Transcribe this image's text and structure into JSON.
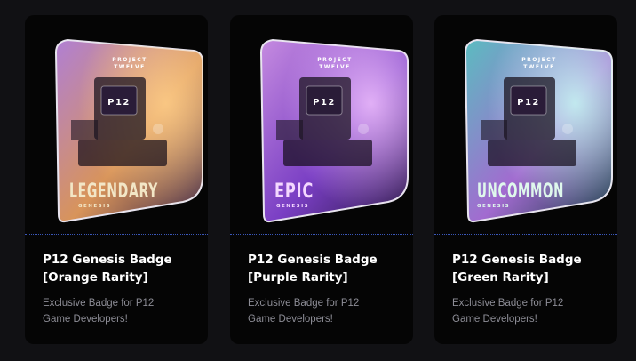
{
  "cards": [
    {
      "title_line1": "P12 Genesis Badge",
      "title_line2": "[Orange Rarity]",
      "description_line1": "Exclusive Badge for P12",
      "description_line2": "Game Developers!",
      "badge": {
        "rarity": "LEGENDARY",
        "subtitle": "GENESIS",
        "header_line1": "PROJECT",
        "header_line2": "TWELVE",
        "screen_text": "P12",
        "colors": {
          "top": "#b07fd4",
          "mid": "#d8945a",
          "bottom": "#3a2548",
          "glow": "#ffcf8a",
          "text": "#f2e6c6"
        }
      }
    },
    {
      "title_line1": "P12 Genesis Badge",
      "title_line2": "[Purple Rarity]",
      "description_line1": "Exclusive Badge for P12",
      "description_line2": "Game Developers!",
      "badge": {
        "rarity": "EPIC",
        "subtitle": "GENESIS",
        "header_line1": "PROJECT",
        "header_line2": "TWELVE",
        "screen_text": "P12",
        "colors": {
          "top": "#c58be0",
          "mid": "#7a3fc4",
          "bottom": "#2a1746",
          "glow": "#f3c3ff",
          "text": "#f4d8ff"
        }
      }
    },
    {
      "title_line1": "P12 Genesis Badge",
      "title_line2": "[Green Rarity]",
      "description_line1": "Exclusive Badge for P12",
      "description_line2": "Game Developers!",
      "badge": {
        "rarity": "UNCOMMON",
        "subtitle": "GENESIS",
        "header_line1": "PROJECT",
        "header_line2": "TWELVE",
        "screen_text": "P12",
        "colors": {
          "top": "#5bbcc0",
          "mid": "#a26bd0",
          "bottom": "#173a44",
          "glow": "#c7fff4",
          "text": "#dff8ec"
        }
      }
    }
  ]
}
